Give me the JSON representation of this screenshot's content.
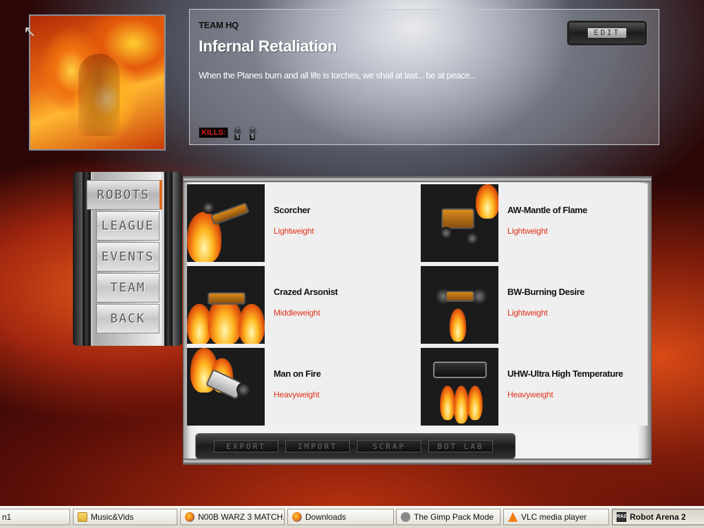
{
  "team": {
    "section_label": "TEAM HQ",
    "name": "Infernal Retaliation",
    "motto": "When the Planes burn and all life is torches, we shall at last... be at peace...",
    "kills_label": "KILLS:",
    "kill_badges": [
      "5",
      "5"
    ],
    "edit_label": "EDIT"
  },
  "nav": {
    "items": [
      {
        "label": "ROBOTS",
        "active": true
      },
      {
        "label": "LEAGUE",
        "active": false
      },
      {
        "label": "EVENTS",
        "active": false
      },
      {
        "label": "TEAM",
        "active": false
      },
      {
        "label": "BACK",
        "active": false
      }
    ]
  },
  "robots": [
    {
      "name": "Scorcher",
      "weight_class": "Lightweight"
    },
    {
      "name": "AW-Mantle of Flame",
      "weight_class": "Lightweight"
    },
    {
      "name": "Crazed Arsonist",
      "weight_class": "Middleweight"
    },
    {
      "name": "BW-Burning Desire",
      "weight_class": "Lightweight"
    },
    {
      "name": "Man on Fire",
      "weight_class": "Heavyweight"
    },
    {
      "name": "UHW-Ultra High Temperature",
      "weight_class": "Heavyweight"
    }
  ],
  "actions": {
    "export_label": "EXPORT",
    "import_label": "IMPORT",
    "scrap_label": "SCRAP",
    "botlab_label": "BOT LAB"
  },
  "taskbar": {
    "items": [
      {
        "label": "n1",
        "icon": "none"
      },
      {
        "label": "Music&Vids",
        "icon": "folder-icon"
      },
      {
        "label": "N00B WARZ 3 MATCH...",
        "icon": "firefox-icon"
      },
      {
        "label": "Downloads",
        "icon": "firefox-icon"
      },
      {
        "label": "The Gimp Pack Mode",
        "icon": "gimp-icon"
      },
      {
        "label": "VLC media player",
        "icon": "vlc-icon"
      },
      {
        "label": "Robot Arena 2",
        "icon": "robot-arena-icon"
      }
    ]
  },
  "colors": {
    "weight_class": "#e0321c",
    "kills_label": "#e0241c",
    "nav_active_accent": "#e06a20"
  }
}
